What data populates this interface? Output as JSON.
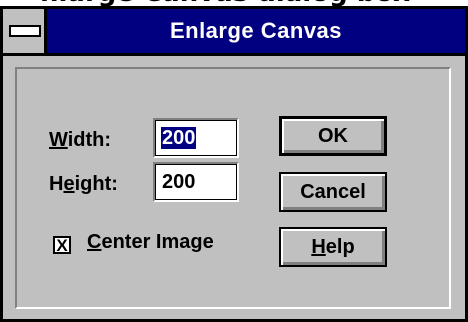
{
  "window": {
    "title": "Enlarge Canvas",
    "behind_title": "nlarge Canvas dialog box"
  },
  "form": {
    "width_label": {
      "mnemonic": "W",
      "rest": "idth:"
    },
    "width_value": "200",
    "height_label": {
      "pre": "H",
      "mnemonic": "e",
      "rest": "ight:"
    },
    "height_value": "200",
    "center_image": {
      "checked": true,
      "mark": "X",
      "mnemonic": "C",
      "rest": "enter Image"
    }
  },
  "buttons": {
    "ok": "OK",
    "cancel": "Cancel",
    "help": {
      "mnemonic": "H",
      "rest": "elp"
    }
  },
  "icons": {
    "system_menu": "system-menu-icon"
  },
  "colors": {
    "titlebar": "#000080",
    "face": "#c0c0c0",
    "selection": "#000080"
  }
}
